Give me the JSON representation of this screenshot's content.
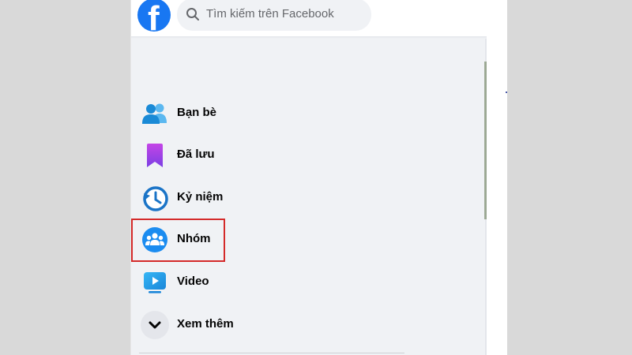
{
  "app": {
    "logo_letter": "f"
  },
  "search": {
    "placeholder": "Tìm kiếm trên Facebook"
  },
  "sidebar": {
    "items": [
      {
        "label": "Bạn bè",
        "icon": "friends-icon"
      },
      {
        "label": "Đã lưu",
        "icon": "saved-bookmark-icon"
      },
      {
        "label": "Kỷ niệm",
        "icon": "memories-clock-icon"
      },
      {
        "label": "Nhóm",
        "icon": "groups-icon"
      },
      {
        "label": "Video",
        "icon": "video-icon"
      },
      {
        "label": "Xem thêm",
        "icon": "chevron-down-icon"
      }
    ],
    "highlighted_item": "Nhóm"
  },
  "colors": {
    "brand": "#1877f2",
    "highlight_border": "#d42a2a",
    "sidebar_bg": "#f0f2f5"
  }
}
